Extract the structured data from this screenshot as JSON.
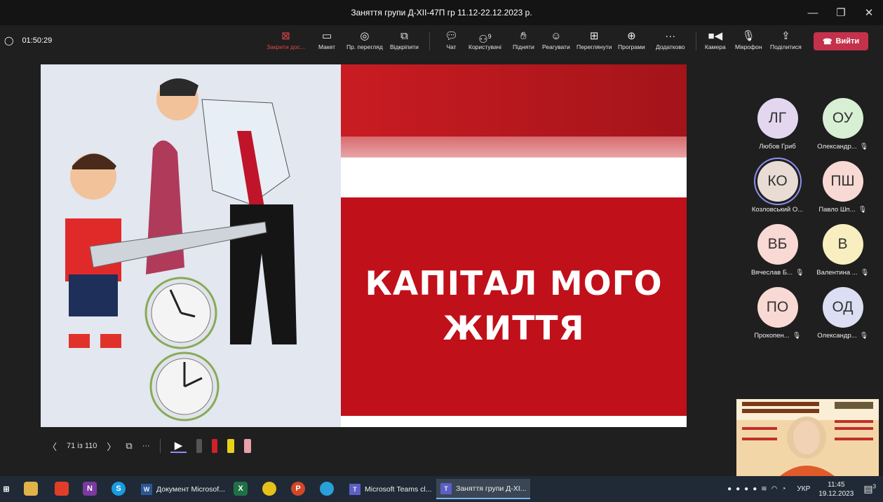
{
  "window": {
    "title": "Заняття групи Д-ХІІ-47П гр 11.12-22.12.2023 р.",
    "minimize": "—",
    "maximize": "❐",
    "close": "✕"
  },
  "meeting": {
    "elapsed": "01:50:29",
    "shield_icon": "shield-icon"
  },
  "toolbar": {
    "stop_share": "Закрити дос...",
    "layout": "Макет",
    "view": "Пр. перегляд",
    "popout": "Відкріпити",
    "chat": "Чат",
    "people": "Користувачі",
    "people_count": "9",
    "raise": "Підняти",
    "react": "Реагувати",
    "view_all": "Переглянути",
    "apps": "Програми",
    "more": "Додатково",
    "more_glyph": "···",
    "camera": "Камера",
    "mic": "Мікрофон",
    "share": "Поділитися",
    "leave": "Вийти",
    "accent": "#c4314b"
  },
  "slide": {
    "title_line1": "КАПІТАЛ МОГО",
    "title_line2": "ЖИТТЯ",
    "counter": "71 із 110",
    "prev": "〈",
    "next": "〉",
    "more": "···",
    "accent": "#c0101a"
  },
  "participants": [
    {
      "initials": "ЛГ",
      "name": "Любов Гриб",
      "muted": false,
      "color": "#e3d7f0"
    },
    {
      "initials": "ОУ",
      "name": "Олександр...",
      "muted": true,
      "color": "#d7f0d3"
    },
    {
      "initials": "КО",
      "name": "Козловський О...",
      "muted": false,
      "color": "#e9dcd4"
    },
    {
      "initials": "ПШ",
      "name": "Павло Шп...",
      "muted": true,
      "color": "#f9d9d3"
    },
    {
      "initials": "ВБ",
      "name": "Вячеслав Б...",
      "muted": true,
      "color": "#f9d9d3"
    },
    {
      "initials": "В",
      "name": "Валентина ...",
      "muted": true,
      "color": "#f8eebf"
    },
    {
      "initials": "ПО",
      "name": "Прокопен...",
      "muted": true,
      "color": "#f9d9d3"
    },
    {
      "initials": "ОД",
      "name": "Олександр...",
      "muted": true,
      "color": "#dcdff3"
    }
  ],
  "taskbar": {
    "word_app": "Документ Microsof...",
    "teams_app": "Microsoft Teams cl...",
    "meeting_app": "Заняття групи Д-ХІ...",
    "language": "УКР",
    "time": "11:45",
    "date": "19.12.2023",
    "notif_count": "3"
  }
}
